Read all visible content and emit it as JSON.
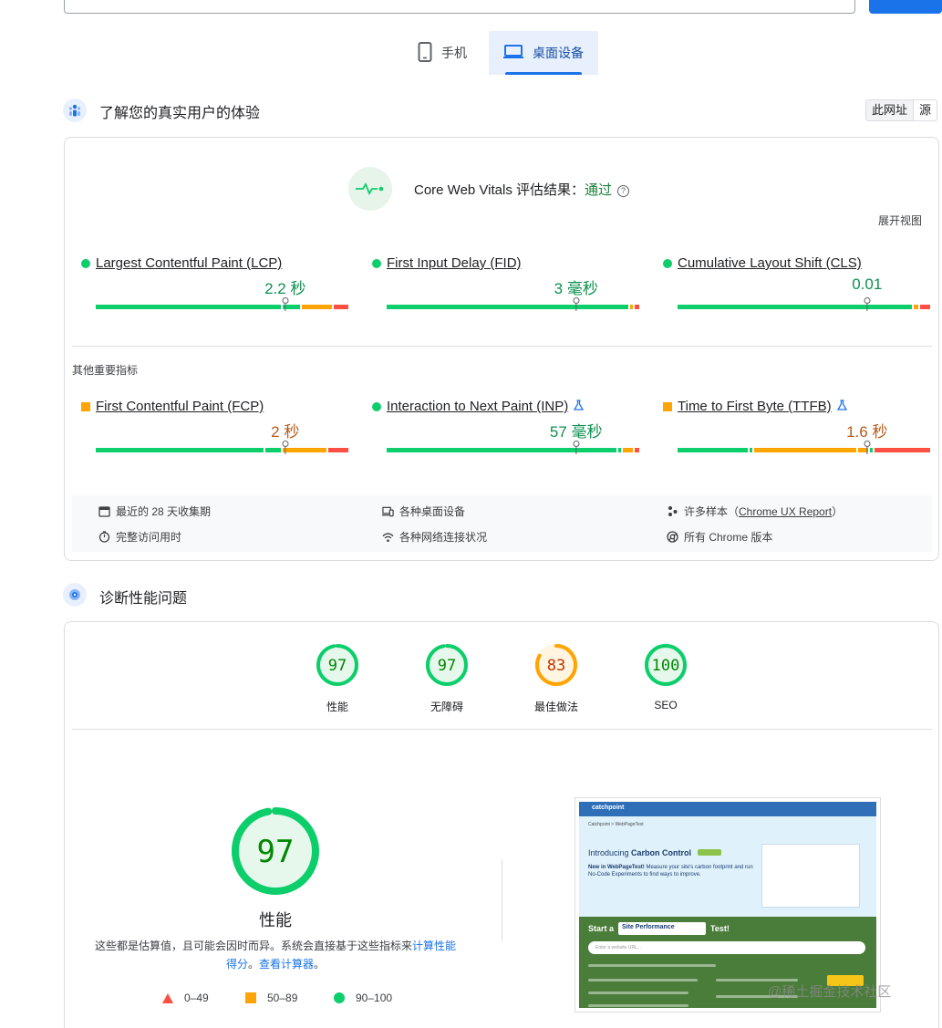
{
  "device_tabs": {
    "mobile": "手机",
    "desktop": "桌面设备"
  },
  "field_data": {
    "title": "了解您的真实用户的体验",
    "toggle": {
      "this_url": "此网址",
      "origin": "源"
    },
    "cwv_label": "Core Web Vitals 评估结果：",
    "cwv_result": "通过",
    "help_glyph": "?",
    "expand_view": "展开视图",
    "core_metrics": [
      {
        "name": "Largest Contentful Paint (LCP)",
        "value": "2.2 秒",
        "status": "good",
        "distribution_pct": [
          75,
          7,
          12,
          6
        ],
        "marker_pct": 75
      },
      {
        "name": "First Input Delay (FID)",
        "value": "3 毫秒",
        "status": "good",
        "distribution_pct": [
          97,
          1,
          2
        ],
        "marker_pct": 75
      },
      {
        "name": "Cumulative Layout Shift (CLS)",
        "value": "0.01",
        "status": "good",
        "distribution_pct": [
          94,
          2,
          4
        ],
        "marker_pct": 75
      }
    ],
    "other_label": "其他重要指标",
    "other_metrics": [
      {
        "name": "First Contentful Paint (FCP)",
        "value": "2 秒",
        "status": "average",
        "experimental": false,
        "distribution_pct": [
          68,
          6,
          18,
          8
        ],
        "marker_pct": 75
      },
      {
        "name": "Interaction to Next Paint (INP)",
        "value": "57 毫秒",
        "status": "good",
        "experimental": true,
        "distribution_pct": [
          93,
          1,
          4,
          2
        ],
        "marker_pct": 75
      },
      {
        "name": "Time to First Byte (TTFB)",
        "value": "1.6 秒",
        "status": "average",
        "experimental": true,
        "distribution_pct": [
          29,
          1,
          42,
          4,
          1,
          23
        ],
        "marker_pct": 75
      }
    ],
    "info": {
      "collection_period": "最近的 28 天收集期",
      "devices": "各种桌面设备",
      "samples_prefix": "许多样本（",
      "samples_link": "Chrome UX Report",
      "samples_suffix": "）",
      "full_visit": "完整访问用时",
      "networks": "各种网络连接状况",
      "chrome_versions": "所有 Chrome 版本"
    }
  },
  "diagnostics": {
    "title": "诊断性能问题",
    "scores": [
      {
        "name": "性能",
        "score": 97,
        "color": "#0cce6b",
        "fill": "#e6f7ec",
        "text": "#008800"
      },
      {
        "name": "无障碍",
        "score": 97,
        "color": "#0cce6b",
        "fill": "#e6f7ec",
        "text": "#008800"
      },
      {
        "name": "最佳做法",
        "score": 83,
        "color": "#ffa400",
        "fill": "#fff5e0",
        "text": "#c33300"
      },
      {
        "name": "SEO",
        "score": 100,
        "color": "#0cce6b",
        "fill": "#e6f7ec",
        "text": "#008800"
      }
    ],
    "big_score": 97,
    "big_label": "性能",
    "description_part1": "这些都是估算值，且可能会因时而异。系统会直接基于这些指标来",
    "description_link1": "计算性能得分",
    "description_part2": "。",
    "description_link2": "查看计算器",
    "description_part3": "。",
    "legend": [
      {
        "shape": "triangle",
        "color": "#ff4e42",
        "range": "0–49"
      },
      {
        "shape": "square",
        "color": "#ffa400",
        "range": "50–89"
      },
      {
        "shape": "circle",
        "color": "#0cce6b",
        "range": "90–100"
      }
    ]
  },
  "screenshot": {
    "brand": "catchpoint",
    "crumb": "Catchpoint > WebPageTest",
    "heading_prefix": "Introducing ",
    "heading_bold": "Carbon Control",
    "paragraph_bold": "New in WebPageTest!",
    "paragraph": " Measure your site's carbon footprint and run No-Code Experiments to find ways to improve.",
    "start_prefix": "Start a",
    "select_value": "Site Performance",
    "start_suffix": "Test!",
    "input_placeholder": "Enter a website URL..."
  },
  "watermark": "@稀土掘金技术社区",
  "colors": {
    "good": "#0cce6b",
    "average": "#ffa400",
    "poor": "#ff4e42",
    "accent": "#1a73e8"
  }
}
